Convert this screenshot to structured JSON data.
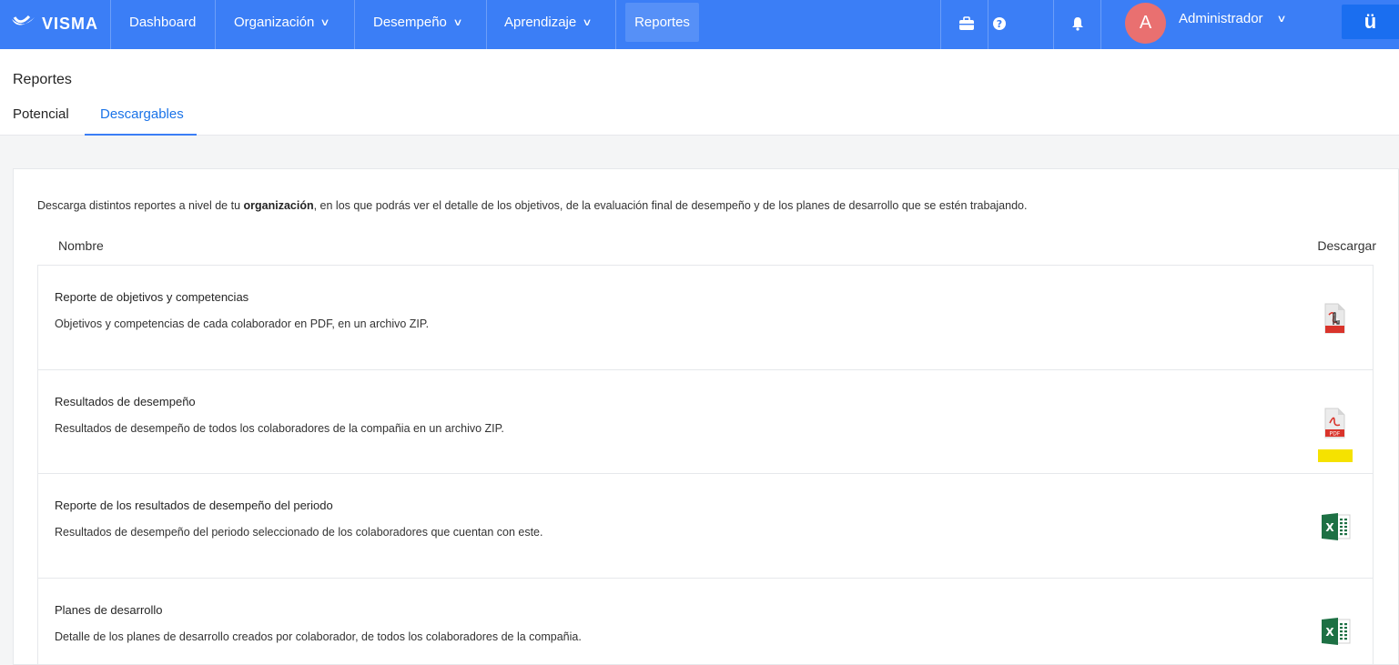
{
  "topbar": {
    "brand": "VISMA",
    "nav": [
      {
        "label": "Dashboard"
      },
      {
        "label": "Organización"
      },
      {
        "label": "Desempeño"
      },
      {
        "label": "Aprendizaje"
      },
      {
        "label": "Reportes"
      }
    ],
    "chevron": "∨",
    "icons": [
      "briefcase-icon",
      "help-icon",
      "bell-icon"
    ],
    "avatar_initial": "A",
    "user_name": "Administrador",
    "app_switcher": "ü"
  },
  "page": {
    "title": "Reportes",
    "tabs": [
      {
        "label": "Potencial"
      },
      {
        "label": "Descargables"
      }
    ]
  },
  "card": {
    "intro_before": "Descarga distintos reportes a nivel de tu ",
    "intro_bold": "organización",
    "intro_after": ", en los que podrás ver el detalle de los objetivos, de la evaluación final de desempeño y de los planes de desarrollo que se estén trabajando.",
    "col_name": "Nombre",
    "col_download": "Descargar",
    "rows": [
      {
        "title": "Reporte de objetivos y competencias",
        "desc": "Objetivos y competencias de cada colaborador en PDF, en un archivo ZIP.",
        "file": "pdf"
      },
      {
        "title": "Resultados de desempeño",
        "desc": "Resultados de desempeño de todos los colaboradores de la compañia en un archivo ZIP.",
        "file": "pdf"
      },
      {
        "title": "Reporte de los resultados de desempeño del periodo",
        "desc": "Resultados de desempeño del periodo seleccionado de los colaboradores que cuentan con este.",
        "file": "excel"
      },
      {
        "title": "Planes de desarrollo",
        "desc": "Detalle de los planes de desarrollo creados por colaborador, de todos los colaboradores de la compañia.",
        "file": "excel"
      }
    ],
    "pdf_label": "PDF",
    "excel_label": "X"
  },
  "colors": {
    "topbar": "#3b7ef6",
    "accent": "#1a73e8",
    "avatar": "#e97070",
    "pdf_red": "#d9342b",
    "excel_green": "#1d7044",
    "highlight": "#f5e200"
  }
}
